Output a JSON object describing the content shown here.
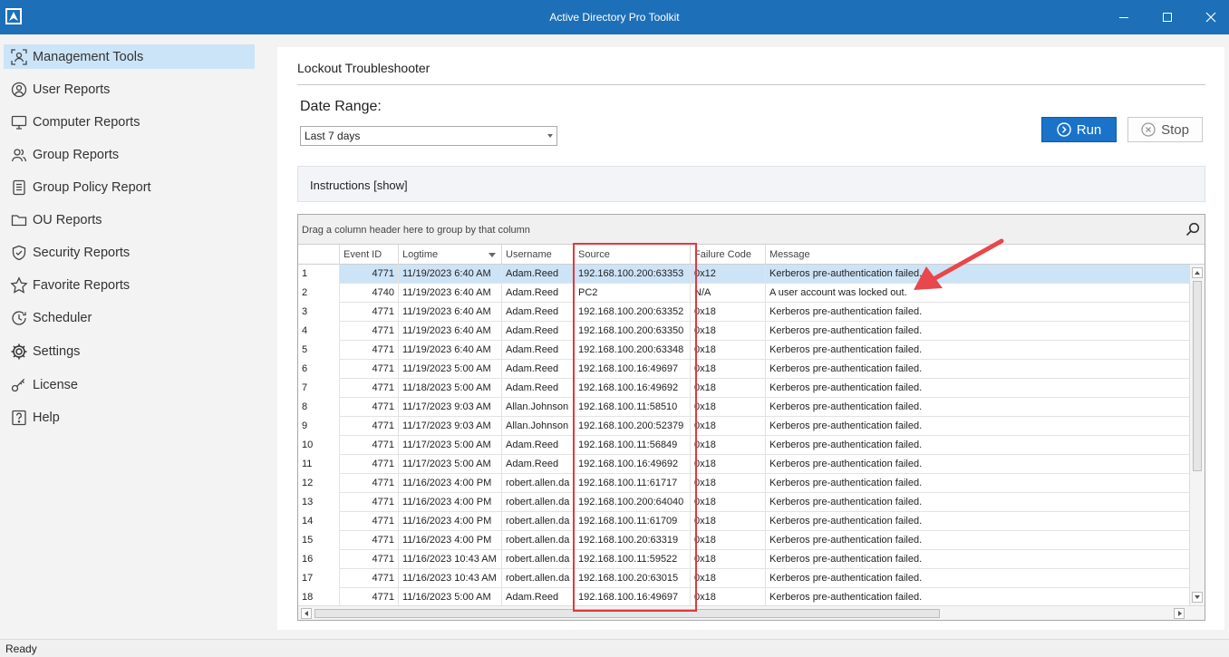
{
  "window": {
    "title": "Active Directory Pro Toolkit"
  },
  "sidebar": {
    "items": [
      {
        "label": "Management Tools",
        "icon": "user-scan-icon",
        "active": true
      },
      {
        "label": "User Reports",
        "icon": "user-circle-icon"
      },
      {
        "label": "Computer Reports",
        "icon": "monitor-icon"
      },
      {
        "label": "Group Reports",
        "icon": "group-icon"
      },
      {
        "label": "Group Policy Report",
        "icon": "document-list-icon"
      },
      {
        "label": "OU Reports",
        "icon": "folder-icon"
      },
      {
        "label": "Security Reports",
        "icon": "shield-check-icon"
      },
      {
        "label": "Favorite Reports",
        "icon": "star-icon"
      },
      {
        "label": "Scheduler",
        "icon": "clock-icon"
      },
      {
        "label": "Settings",
        "icon": "gear-icon"
      },
      {
        "label": "License",
        "icon": "key-icon"
      },
      {
        "label": "Help",
        "icon": "help-icon"
      }
    ]
  },
  "main": {
    "title": "Lockout Troubleshooter",
    "date_range_label": "Date Range:",
    "date_range_value": "Last 7 days",
    "run_label": "Run",
    "stop_label": "Stop",
    "instructions_label": "Instructions [show]"
  },
  "grid": {
    "group_hint": "Drag a column header here to group by that column",
    "columns": [
      "Event ID",
      "Logtime",
      "Username",
      "Source",
      "Failure Code",
      "Message"
    ],
    "rows": [
      {
        "n": "1",
        "event_id": "4771",
        "logtime": "11/19/2023 6:40 AM",
        "username": "Adam.Reed",
        "source": "192.168.100.200:63353",
        "failure_code": "0x12",
        "message": "Kerberos pre-authentication failed."
      },
      {
        "n": "2",
        "event_id": "4740",
        "logtime": "11/19/2023 6:40 AM",
        "username": "Adam.Reed",
        "source": "PC2",
        "failure_code": "N/A",
        "message": "A user account was locked out."
      },
      {
        "n": "3",
        "event_id": "4771",
        "logtime": "11/19/2023 6:40 AM",
        "username": "Adam.Reed",
        "source": "192.168.100.200:63352",
        "failure_code": "0x18",
        "message": "Kerberos pre-authentication failed."
      },
      {
        "n": "4",
        "event_id": "4771",
        "logtime": "11/19/2023 6:40 AM",
        "username": "Adam.Reed",
        "source": "192.168.100.200:63350",
        "failure_code": "0x18",
        "message": "Kerberos pre-authentication failed."
      },
      {
        "n": "5",
        "event_id": "4771",
        "logtime": "11/19/2023 6:40 AM",
        "username": "Adam.Reed",
        "source": "192.168.100.200:63348",
        "failure_code": "0x18",
        "message": "Kerberos pre-authentication failed."
      },
      {
        "n": "6",
        "event_id": "4771",
        "logtime": "11/19/2023 5:00 AM",
        "username": "Adam.Reed",
        "source": "192.168.100.16:49697",
        "failure_code": "0x18",
        "message": "Kerberos pre-authentication failed."
      },
      {
        "n": "7",
        "event_id": "4771",
        "logtime": "11/18/2023 5:00 AM",
        "username": "Adam.Reed",
        "source": "192.168.100.16:49692",
        "failure_code": "0x18",
        "message": "Kerberos pre-authentication failed."
      },
      {
        "n": "8",
        "event_id": "4771",
        "logtime": "11/17/2023 9:03 AM",
        "username": "Allan.Johnson",
        "source": "192.168.100.11:58510",
        "failure_code": "0x18",
        "message": "Kerberos pre-authentication failed."
      },
      {
        "n": "9",
        "event_id": "4771",
        "logtime": "11/17/2023 9:03 AM",
        "username": "Allan.Johnson",
        "source": "192.168.100.200:52379",
        "failure_code": "0x18",
        "message": "Kerberos pre-authentication failed."
      },
      {
        "n": "10",
        "event_id": "4771",
        "logtime": "11/17/2023 5:00 AM",
        "username": "Adam.Reed",
        "source": "192.168.100.11:56849",
        "failure_code": "0x18",
        "message": "Kerberos pre-authentication failed."
      },
      {
        "n": "11",
        "event_id": "4771",
        "logtime": "11/17/2023 5:00 AM",
        "username": "Adam.Reed",
        "source": "192.168.100.16:49692",
        "failure_code": "0x18",
        "message": "Kerberos pre-authentication failed."
      },
      {
        "n": "12",
        "event_id": "4771",
        "logtime": "11/16/2023 4:00 PM",
        "username": "robert.allen.da",
        "source": "192.168.100.11:61717",
        "failure_code": "0x18",
        "message": "Kerberos pre-authentication failed."
      },
      {
        "n": "13",
        "event_id": "4771",
        "logtime": "11/16/2023 4:00 PM",
        "username": "robert.allen.da",
        "source": "192.168.100.200:64040",
        "failure_code": "0x18",
        "message": "Kerberos pre-authentication failed."
      },
      {
        "n": "14",
        "event_id": "4771",
        "logtime": "11/16/2023 4:00 PM",
        "username": "robert.allen.da",
        "source": "192.168.100.11:61709",
        "failure_code": "0x18",
        "message": "Kerberos pre-authentication failed."
      },
      {
        "n": "15",
        "event_id": "4771",
        "logtime": "11/16/2023 4:00 PM",
        "username": "robert.allen.da",
        "source": "192.168.100.20:63319",
        "failure_code": "0x18",
        "message": "Kerberos pre-authentication failed."
      },
      {
        "n": "16",
        "event_id": "4771",
        "logtime": "11/16/2023 10:43 AM",
        "username": "robert.allen.da",
        "source": "192.168.100.11:59522",
        "failure_code": "0x18",
        "message": "Kerberos pre-authentication failed."
      },
      {
        "n": "17",
        "event_id": "4771",
        "logtime": "11/16/2023 10:43 AM",
        "username": "robert.allen.da",
        "source": "192.168.100.20:63015",
        "failure_code": "0x18",
        "message": "Kerberos pre-authentication failed."
      },
      {
        "n": "18",
        "event_id": "4771",
        "logtime": "11/16/2023 5:00 AM",
        "username": "Adam.Reed",
        "source": "192.168.100.16:49697",
        "failure_code": "0x18",
        "message": "Kerberos pre-authentication failed."
      }
    ]
  },
  "status": {
    "text": "Ready"
  },
  "colors": {
    "titlebar": "#1d6fb8",
    "accent": "#1a73c9",
    "selection": "#cde3f6",
    "annotation": "#e0393e"
  }
}
